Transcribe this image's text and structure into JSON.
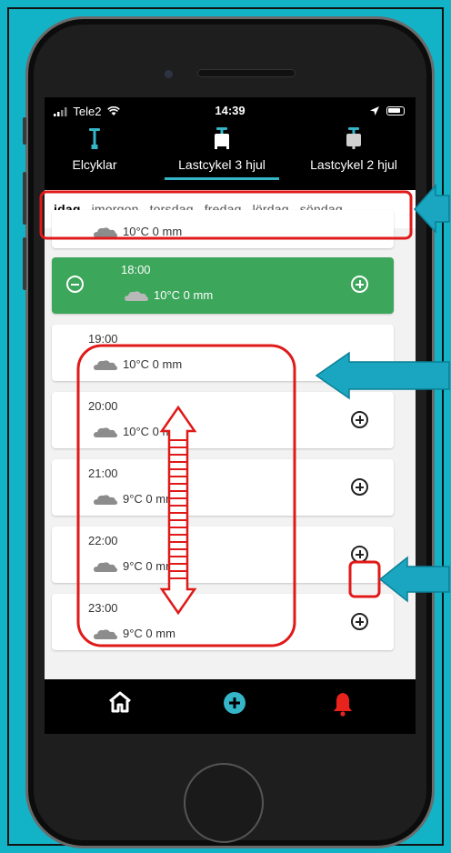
{
  "status_bar": {
    "carrier": "Tele2",
    "time": "14:39"
  },
  "vehicle_tabs": [
    {
      "label": "Elcyklar",
      "icon": "bike-icon",
      "active": false
    },
    {
      "label": "Lastcykel 3 hjul",
      "icon": "cargo-bike-3-wheel-icon",
      "active": true
    },
    {
      "label": "Lastcykel 2 hjul",
      "icon": "cargo-bike-2-wheel-icon",
      "active": false
    }
  ],
  "day_tabs": [
    "idag",
    "imorgon",
    "torsdag",
    "fredag",
    "lördag",
    "söndag"
  ],
  "active_day": "idag",
  "time_slots": [
    {
      "time": "",
      "weather": "10°C 0 mm",
      "selected": false,
      "has_add": false
    },
    {
      "time": "18:00",
      "weather": "10°C 0 mm",
      "selected": true,
      "has_add": true
    },
    {
      "time": "19:00",
      "weather": "10°C 0 mm",
      "selected": false,
      "has_add": false
    },
    {
      "time": "20:00",
      "weather": "10°C 0 mm",
      "selected": false,
      "has_add": true
    },
    {
      "time": "21:00",
      "weather": "9°C 0 mm",
      "selected": false,
      "has_add": true
    },
    {
      "time": "22:00",
      "weather": "9°C 0 mm",
      "selected": false,
      "has_add": true
    },
    {
      "time": "23:00",
      "weather": "9°C 0 mm",
      "selected": false,
      "has_add": true
    }
  ],
  "bottom_nav": [
    {
      "icon": "home-icon"
    },
    {
      "icon": "add-circle-icon"
    },
    {
      "icon": "bell-icon"
    }
  ],
  "colors": {
    "background": "#12b3c6",
    "selected_slot": "#3ca65b",
    "accent": "#35b6c8",
    "annotation_red": "#e01919",
    "annotation_arrow": "#1aa6c0",
    "bell": "#e8231e"
  }
}
